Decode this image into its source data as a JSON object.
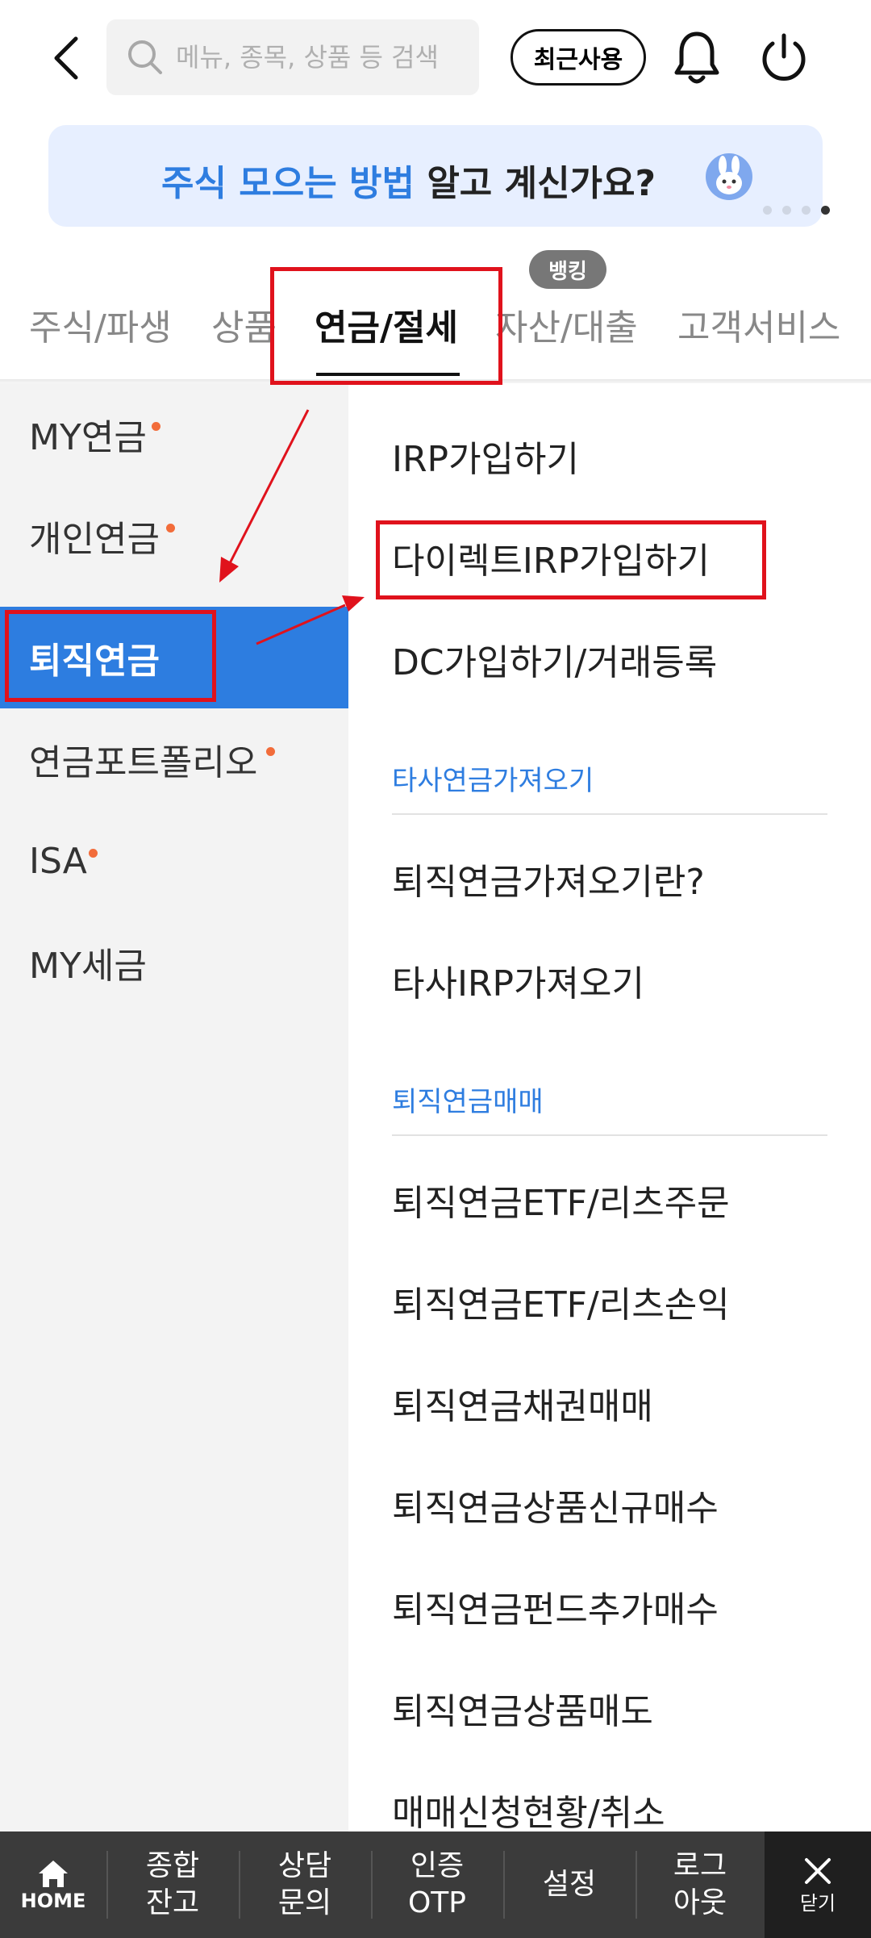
{
  "header": {
    "search_placeholder": "메뉴, 종목, 상품 등 검색",
    "recent_label": "최근사용"
  },
  "banner": {
    "highlight": "주식 모으는 방법",
    "text": " 알고 계신가요?",
    "page_count": 4,
    "active_page": 4
  },
  "tabs": {
    "items": [
      "주식/파생",
      "상품",
      "연금/절세",
      "자산/대출",
      "고객서비스"
    ],
    "active": "연금/절세",
    "badge": "뱅킹"
  },
  "left_menu": {
    "items": [
      "MY연금",
      "개인연금",
      "퇴직연금",
      "연금포트폴리오",
      "ISA",
      "MY세금"
    ],
    "active": "퇴직연금"
  },
  "right_menu": {
    "group1": [
      "IRP가입하기",
      "다이렉트IRP가입하기",
      "DC가입하기/거래등록"
    ],
    "section2_title": "타사연금가져오기",
    "group2": [
      "퇴직연금가져오기란?",
      "타사IRP가져오기"
    ],
    "section3_title": "퇴직연금매매",
    "group3": [
      "퇴직연금ETF/리츠주문",
      "퇴직연금ETF/리츠손익",
      "퇴직연금채권매매",
      "퇴직연금상품신규매수",
      "퇴직연금펀드추가매수",
      "퇴직연금상품매도",
      "매매신청현황/취소"
    ]
  },
  "bottom_bar": {
    "home": "HOME",
    "items": [
      {
        "line1": "종합",
        "line2": "잔고"
      },
      {
        "line1": "상담",
        "line2": "문의"
      },
      {
        "line1": "인증",
        "line2": "OTP"
      },
      {
        "line1": "설정",
        "line2": ""
      },
      {
        "line1": "로그",
        "line2": "아웃"
      }
    ],
    "close": "닫기"
  },
  "colors": {
    "accent": "#2d7de0",
    "annotation": "#e0121c",
    "notify_dot": "#f26c3a"
  }
}
